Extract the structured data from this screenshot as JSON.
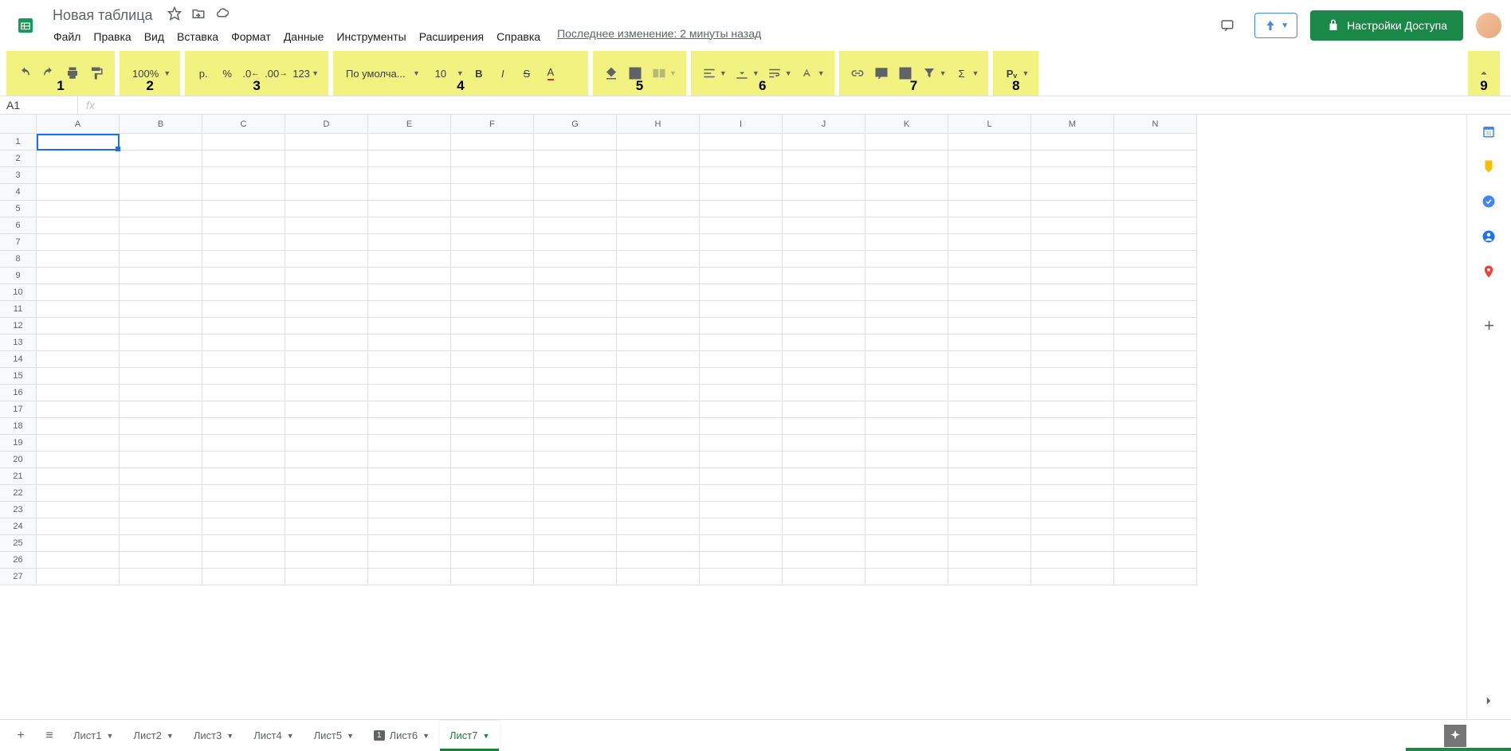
{
  "doc": {
    "title": "Новая таблица"
  },
  "menu": [
    "Файл",
    "Правка",
    "Вид",
    "Вставка",
    "Формат",
    "Данные",
    "Инструменты",
    "Расширения",
    "Справка"
  ],
  "last_edit": "Последнее изменение: 2 минуты назад",
  "share_label": "Настройки Доступа",
  "zoom": "100%",
  "currency_symbol": "р.",
  "font_name": "По умолча...",
  "font_size": "10",
  "number_format_label": "123",
  "python_label": "Pᵥ",
  "group_labels": [
    "1",
    "2",
    "3",
    "4",
    "5",
    "6",
    "7",
    "8",
    "9"
  ],
  "name_box": "A1",
  "fx_label": "fx",
  "columns": [
    "A",
    "B",
    "C",
    "D",
    "E",
    "F",
    "G",
    "H",
    "I",
    "J",
    "K",
    "L",
    "M",
    "N"
  ],
  "row_count": 27,
  "selected_cell": "A1",
  "sheets": [
    {
      "name": "Лист1",
      "active": false,
      "badge": false
    },
    {
      "name": "Лист2",
      "active": false,
      "badge": false
    },
    {
      "name": "Лист3",
      "active": false,
      "badge": false
    },
    {
      "name": "Лист4",
      "active": false,
      "badge": false
    },
    {
      "name": "Лист5",
      "active": false,
      "badge": false
    },
    {
      "name": "Лист6",
      "active": false,
      "badge": true
    },
    {
      "name": "Лист7",
      "active": true,
      "badge": false
    }
  ]
}
